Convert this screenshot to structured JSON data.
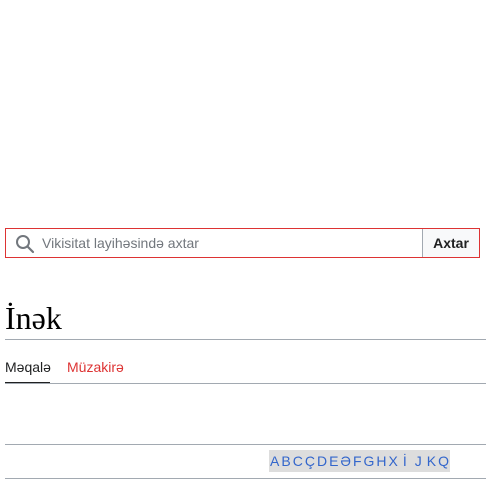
{
  "search": {
    "placeholder": "Vikisitat layihəsində axtar",
    "value": "",
    "button_label": "Axtar",
    "icon": "search-icon"
  },
  "page": {
    "title": "İnək"
  },
  "tabs": [
    {
      "label": "Məqalə",
      "active": true
    },
    {
      "label": "Müzakirə",
      "active": false,
      "color": "#dd3333"
    }
  ],
  "alphabet": [
    "A",
    "B",
    "C",
    "Ç",
    "D",
    "E",
    "Ə",
    "F",
    "G",
    "H",
    "X",
    "İ",
    "J",
    "K",
    "Q"
  ],
  "colors": {
    "accent": "#dd3333",
    "link": "#3366cc",
    "alphabet_bg": "#dddddd"
  }
}
